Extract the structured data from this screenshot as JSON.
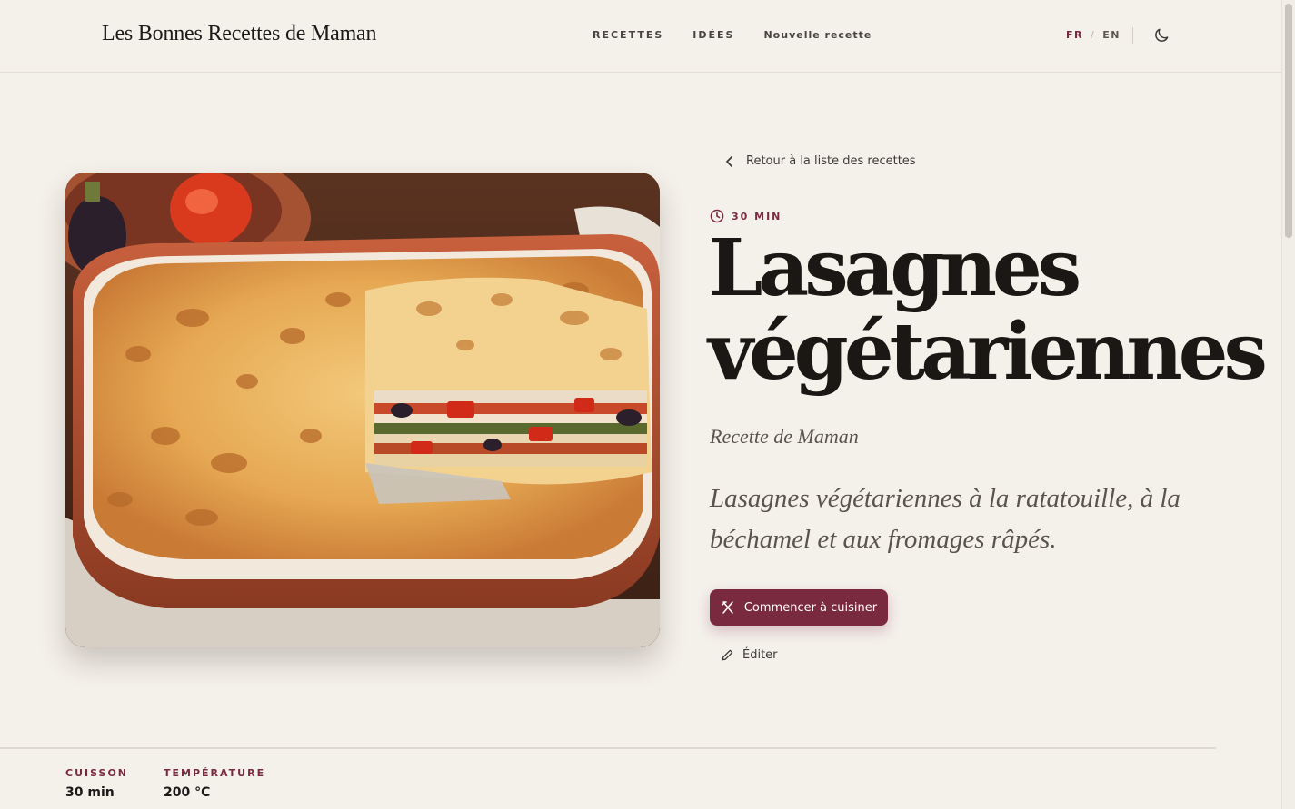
{
  "header": {
    "brand": "Les Bonnes Recettes de Maman",
    "nav": {
      "recettes": "RECETTES",
      "idees": "IDÉES",
      "nouvelle": "Nouvelle recette"
    },
    "lang": {
      "fr": "FR",
      "sep": "/",
      "en": "EN",
      "active": "FR"
    },
    "theme_icon": "moon-icon"
  },
  "recipe": {
    "back_label": "Retour à la liste des recettes",
    "time": "30 MIN",
    "title_line1": "Lasagnes",
    "title_line2": "végétariennes",
    "author": "Recette de Maman",
    "description": "Lasagnes végétariennes à la ratatouille, à la béchamel et aux fromages râpés.",
    "cook_button": "Commencer à cuisiner",
    "edit_label": "Éditer",
    "image_alt": "lasagna-dish-photo"
  },
  "stats": [
    {
      "label": "CUISSON",
      "value": "30 min"
    },
    {
      "label": "TEMPÉRATURE",
      "value": "200 °C"
    }
  ],
  "colors": {
    "accent": "#7a2a3f",
    "background": "#f4f0ea",
    "text": "#1c1a18"
  }
}
